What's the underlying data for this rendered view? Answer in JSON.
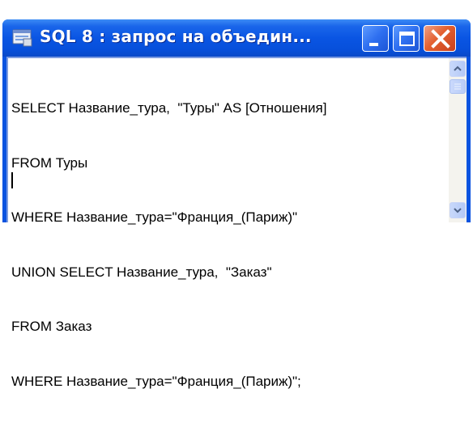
{
  "window": {
    "title": "SQL 8 : запрос на объедин...",
    "app_icon": "query-icon",
    "controls": {
      "minimize": "minimize-icon",
      "maximize": "maximize-icon",
      "close": "close-icon"
    }
  },
  "editor": {
    "lines": [
      "SELECT Название_тура,  \"Туры\" AS [Отношения]",
      "FROM Туры",
      "WHERE Название_тура=\"Франция_(Париж)\"",
      "UNION SELECT Название_тура,  \"Заказ\"",
      "FROM Заказ",
      "WHERE Название_тура=\"Франция_(Париж)\";"
    ]
  },
  "colors": {
    "titlebar": "#0a55e3",
    "close_button": "#e3602f",
    "text": "#000000"
  }
}
